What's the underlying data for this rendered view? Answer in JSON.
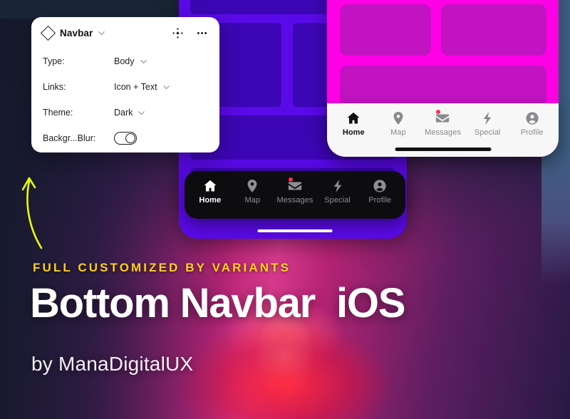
{
  "panel": {
    "title": "Navbar",
    "component_icon": "diamond-icon",
    "move_icon": "move-icon",
    "more_icon": "more-dots-icon",
    "rows": [
      {
        "label": "Type:",
        "value": "Body",
        "control": "dropdown"
      },
      {
        "label": "Links:",
        "value": "Icon + Text",
        "control": "dropdown"
      },
      {
        "label": "Theme:",
        "value": "Dark",
        "control": "dropdown"
      },
      {
        "label": "Backgr...Blur:",
        "value": "",
        "control": "toggle",
        "toggle_on": true
      }
    ]
  },
  "navbar_light": {
    "theme": "Light",
    "background": "#f7f7f7",
    "active_index": 0,
    "items": [
      {
        "label": "Home",
        "icon": "home-icon",
        "badge": false
      },
      {
        "label": "Map",
        "icon": "pin-icon",
        "badge": false
      },
      {
        "label": "Messages",
        "icon": "envelope-icon",
        "badge": true
      },
      {
        "label": "Special",
        "icon": "bolt-icon",
        "badge": false
      },
      {
        "label": "Profile",
        "icon": "person-icon",
        "badge": false
      }
    ]
  },
  "navbar_dark": {
    "theme": "Dark",
    "background": "#0d0d0f",
    "active_index": 0,
    "items": [
      {
        "label": "Home",
        "icon": "home-icon",
        "badge": false
      },
      {
        "label": "Map",
        "icon": "pin-icon",
        "badge": false
      },
      {
        "label": "Messages",
        "icon": "envelope-icon",
        "badge": true
      },
      {
        "label": "Special",
        "icon": "bolt-icon",
        "badge": false
      },
      {
        "label": "Profile",
        "icon": "person-icon",
        "badge": false
      }
    ]
  },
  "hero": {
    "kicker": "FULL CUSTOMIZED BY VARIANTS",
    "headline": "Bottom Navbar  iOS",
    "byline": "by ManaDigitalUX"
  },
  "colors": {
    "kicker": "#ffd11a",
    "headline": "#ffffff",
    "arrow": "#eaff00",
    "badge": "#ff2d55",
    "phone_blue": "#5a0ae8",
    "phone_blue_block": "#3d06b5",
    "phone_magenta": "#ff00e6",
    "phone_magenta_block": "#c213c2",
    "backdrop": "#1a2636",
    "right_slab": "#3d6083"
  }
}
